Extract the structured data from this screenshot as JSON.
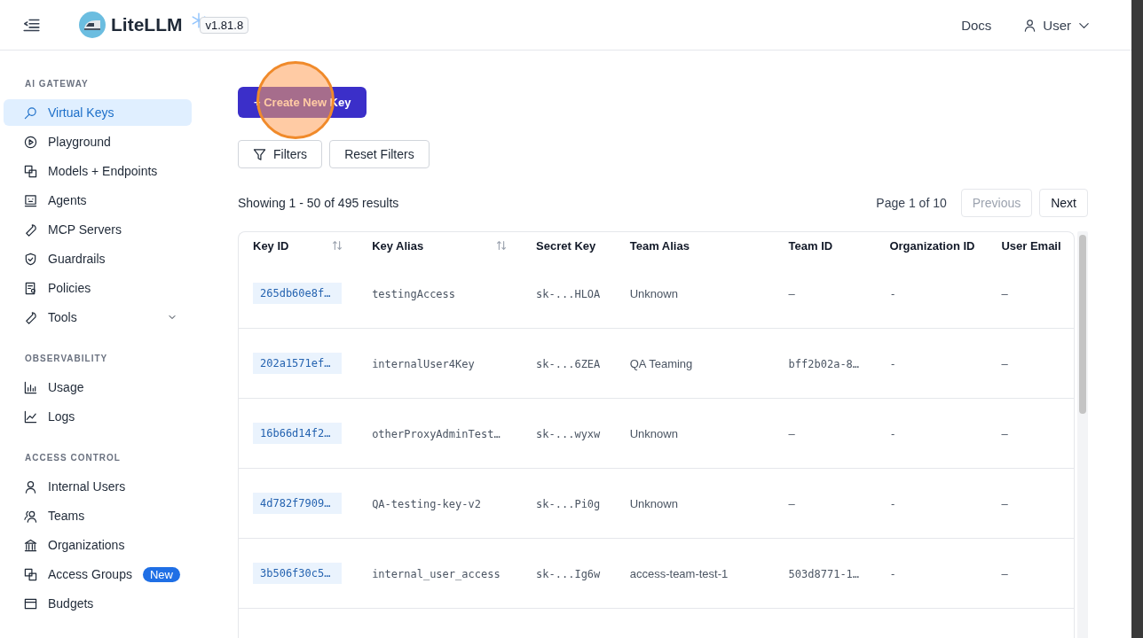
{
  "header": {
    "brand": "LiteLLM",
    "version": "v1.81.8",
    "links": [
      {
        "label": "Docs"
      }
    ],
    "user_menu": {
      "label": "User",
      "expanded": false
    }
  },
  "sidebar": {
    "sections": [
      {
        "title": "AI GATEWAY",
        "items": [
          {
            "label": "Virtual Keys",
            "selected": true
          },
          {
            "label": "Playground",
            "selected": false
          },
          {
            "label": "Models + Endpoints",
            "selected": false
          },
          {
            "label": "Agents",
            "selected": false
          },
          {
            "label": "MCP Servers",
            "selected": false
          },
          {
            "label": "Guardrails",
            "selected": false
          },
          {
            "label": "Policies",
            "selected": false
          },
          {
            "label": "Tools",
            "selected": false,
            "expanded": false
          }
        ]
      },
      {
        "title": "OBSERVABILITY",
        "items": [
          {
            "label": "Usage",
            "selected": false
          },
          {
            "label": "Logs",
            "selected": false
          }
        ]
      },
      {
        "title": "ACCESS CONTROL",
        "items": [
          {
            "label": "Internal Users",
            "selected": false
          },
          {
            "label": "Teams",
            "selected": false
          },
          {
            "label": "Organizations",
            "selected": false
          },
          {
            "label": "Access Groups",
            "selected": false,
            "badge": "New"
          },
          {
            "label": "Budgets",
            "selected": false
          }
        ]
      }
    ]
  },
  "main": {
    "create_button": {
      "label": "+ Create New Key",
      "click_highlight": true
    },
    "filter_buttons": [
      {
        "label": "Filters",
        "kind": "filter"
      },
      {
        "label": "Reset Filters",
        "kind": "plain"
      }
    ],
    "results": "Showing 1 - 50 of 495 results",
    "pagination": {
      "page": "Page 1 of 10",
      "previous": {
        "label": "Previous",
        "disabled": true
      },
      "next": {
        "label": "Next",
        "disabled": false
      }
    },
    "table": {
      "columns": [
        {
          "label": "Key ID",
          "sortable": true,
          "kind": "id"
        },
        {
          "label": "Key Alias",
          "sortable": true,
          "kind": "mono"
        },
        {
          "label": "Secret Key",
          "sortable": false,
          "kind": "mono"
        },
        {
          "label": "Team Alias",
          "sortable": false,
          "kind": "text"
        },
        {
          "label": "Team ID",
          "sortable": false,
          "kind": "mono"
        },
        {
          "label": "Organization ID",
          "sortable": false,
          "kind": "mono"
        },
        {
          "label": "User Email",
          "sortable": false,
          "kind": "text"
        }
      ],
      "rows": [
        [
          "265db60e8f…",
          "testingAccess",
          "sk-...HLOA",
          "Unknown",
          "–",
          "-",
          "–"
        ],
        [
          "202a1571ef…",
          "internalUser4Key",
          "sk-...6ZEA",
          "QA Teaming",
          "bff2b02a-8…",
          "-",
          "–"
        ],
        [
          "16b66d14f2…",
          "otherProxyAdminTest…",
          "sk-...wyxw",
          "Unknown",
          "–",
          "-",
          "–"
        ],
        [
          "4d782f7909…",
          "QA-testing-key-v2",
          "sk-...Pi0g",
          "Unknown",
          "–",
          "-",
          "–"
        ],
        [
          "3b506f30c5…",
          "internal_user_access",
          "sk-...Ig6w",
          "access-team-test-1",
          "503d8771-1…",
          "-",
          "–"
        ]
      ]
    }
  }
}
